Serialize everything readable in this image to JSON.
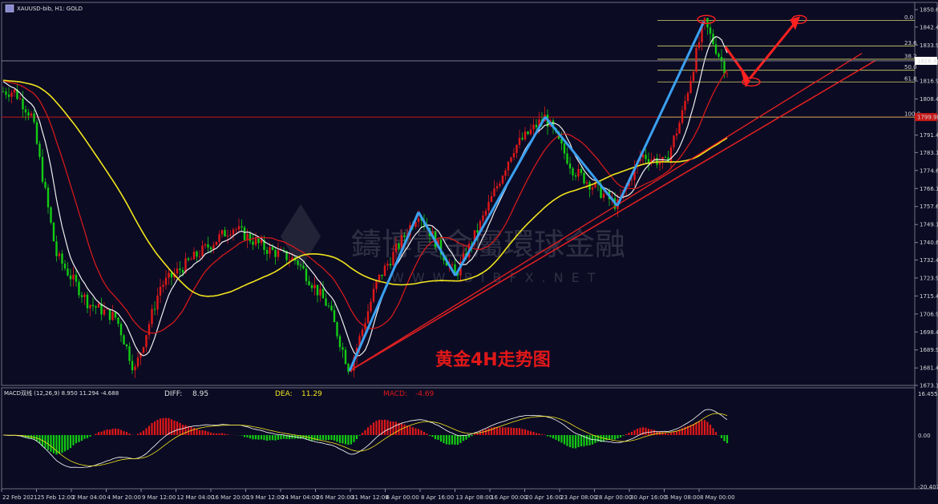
{
  "header": {
    "symbol_label": "XAUUSD-bib, H1:  GOLD",
    "window_icon": "chart-window-icon"
  },
  "watermark": {
    "text": "鑄博貴金屬環球金融",
    "url": "WWW.BIBFX.NET",
    "logo": "bib-logo"
  },
  "annotation": {
    "title": "黄金4H走势图"
  },
  "macd_panel": {
    "title": "MACD双线 (12,26,9) 8.950 11.294 -4.688",
    "diff_label": "DIFF:",
    "diff_value": "8.95",
    "dea_label": "DEA:",
    "dea_value": "11.29",
    "macd_label": "MACD:",
    "macd_value": "-4.69",
    "scale_top": "16.455",
    "scale_mid": "0.00",
    "scale_bottom": "-20.407"
  },
  "price_axis": {
    "ticks": [
      "1850.65",
      "1842.40",
      "1833.90",
      "1825.40",
      "1816.90",
      "1808.40",
      "1799.90",
      "1791.40",
      "1783.15",
      "1774.65",
      "1766.15",
      "1757.65",
      "1749.15",
      "1740.65",
      "1732.40",
      "1723.90",
      "1715.40",
      "1706.90",
      "1698.40",
      "1689.90",
      "1681.40",
      "1673.15"
    ],
    "current_price": "1826.46",
    "level_100_price": "1799.90"
  },
  "fib_levels": [
    {
      "label": "0.0"
    },
    {
      "label": "23.6"
    },
    {
      "label": "38.2"
    },
    {
      "label": "50.0"
    },
    {
      "label": "61.8"
    },
    {
      "label": "100.0"
    }
  ],
  "time_axis": [
    "22 Feb 2021",
    "25 Feb 12:00",
    "2 Mar 04:00",
    "4 Mar 20:00",
    "9 Mar 12:00",
    "12 Mar 04:00",
    "16 Mar 20:00",
    "19 Mar 12:00",
    "24 Mar 04:00",
    "26 Mar 20:00",
    "31 Mar 12:00",
    "6 Apr 00:00",
    "8 Apr 16:00",
    "13 Apr 08:00",
    "16 Apr 00:00",
    "20 Apr 16:00",
    "23 Apr 08:00",
    "28 Apr 00:00",
    "30 Apr 16:00",
    "5 May 08:00",
    "8 May 00:00"
  ],
  "colors": {
    "background": "#0b0b24",
    "bull": "#e01818",
    "bear": "#13cc13",
    "ma_fast": "#f0f0f0",
    "ma_mid": "#d31a1a",
    "ma_slow": "#f2e51c",
    "fib": "#d8d86a",
    "trendline": "#e02020",
    "wave": "#3aa0f0",
    "forecast": "#ff2020"
  },
  "chart_data": {
    "type": "candlestick",
    "title": "黄金4H走势图",
    "ylim": [
      1673.15,
      1850.65
    ],
    "x_range": [
      "22 Feb 2021",
      "8 May 00:00"
    ],
    "anchors": [
      {
        "t": 0,
        "price": 1812
      },
      {
        "t": 18,
        "price": 1812
      },
      {
        "t": 40,
        "price": 1800
      },
      {
        "t": 70,
        "price": 1735
      },
      {
        "t": 110,
        "price": 1712
      },
      {
        "t": 145,
        "price": 1705
      },
      {
        "t": 168,
        "price": 1680
      },
      {
        "t": 200,
        "price": 1720
      },
      {
        "t": 240,
        "price": 1733
      },
      {
        "t": 290,
        "price": 1748
      },
      {
        "t": 330,
        "price": 1738
      },
      {
        "t": 370,
        "price": 1732
      },
      {
        "t": 410,
        "price": 1710
      },
      {
        "t": 436,
        "price": 1680
      },
      {
        "t": 470,
        "price": 1722
      },
      {
        "t": 522,
        "price": 1755
      },
      {
        "t": 548,
        "price": 1738
      },
      {
        "t": 568,
        "price": 1725
      },
      {
        "t": 600,
        "price": 1750
      },
      {
        "t": 640,
        "price": 1785
      },
      {
        "t": 680,
        "price": 1800
      },
      {
        "t": 715,
        "price": 1775
      },
      {
        "t": 770,
        "price": 1758
      },
      {
        "t": 800,
        "price": 1782
      },
      {
        "t": 830,
        "price": 1778
      },
      {
        "t": 850,
        "price": 1800
      },
      {
        "t": 878,
        "price": 1845
      },
      {
        "t": 905,
        "price": 1822
      }
    ],
    "key_points": {
      "low_31_mar": 1680,
      "high_8_may": 1845,
      "fib_0": 1845.5,
      "fib_23_6": 1833.5,
      "fib_38_2": 1827.2,
      "fib_50": 1822,
      "fib_61_8": 1816.5,
      "fib_100": 1799.9
    }
  }
}
